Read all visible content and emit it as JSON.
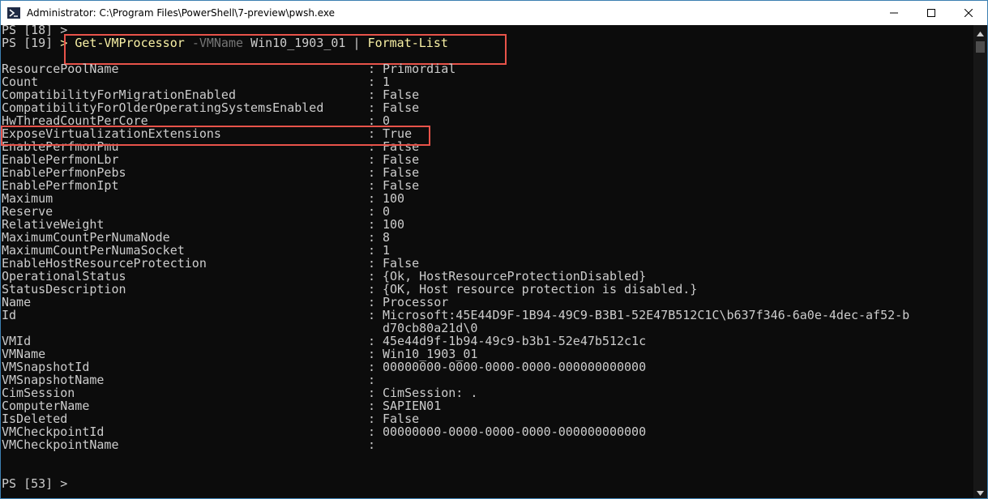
{
  "window": {
    "title": "Administrator: C:\\Program Files\\PowerShell\\7-preview\\pwsh.exe",
    "icon": "powershell-icon"
  },
  "controls": {
    "minimize": "minimize-icon",
    "maximize": "maximize-icon",
    "close": "close-icon"
  },
  "colors": {
    "highlight": "#e8534a",
    "background": "#0c0c0c",
    "text": "#cccccc",
    "command": "#f9f1a5",
    "parameter": "#767676"
  },
  "terminal": {
    "prompt_prev": "PS [18] >",
    "prompt": "PS [19]",
    "command": {
      "arrow": ">",
      "cmdlet": "Get-VMProcessor",
      "param": "-VMName",
      "arg": "Win10_1903_01",
      "pipe": "|",
      "cmdlet2": "Format-List"
    },
    "properties": [
      {
        "name": "ResourcePoolName",
        "value": "Primordial"
      },
      {
        "name": "Count",
        "value": "1"
      },
      {
        "name": "CompatibilityForMigrationEnabled",
        "value": "False"
      },
      {
        "name": "CompatibilityForOlderOperatingSystemsEnabled",
        "value": "False"
      },
      {
        "name": "HwThreadCountPerCore",
        "value": "0"
      },
      {
        "name": "ExposeVirtualizationExtensions",
        "value": "True"
      },
      {
        "name": "EnablePerfmonPmu",
        "value": "False"
      },
      {
        "name": "EnablePerfmonLbr",
        "value": "False"
      },
      {
        "name": "EnablePerfmonPebs",
        "value": "False"
      },
      {
        "name": "EnablePerfmonIpt",
        "value": "False"
      },
      {
        "name": "Maximum",
        "value": "100"
      },
      {
        "name": "Reserve",
        "value": "0"
      },
      {
        "name": "RelativeWeight",
        "value": "100"
      },
      {
        "name": "MaximumCountPerNumaNode",
        "value": "8"
      },
      {
        "name": "MaximumCountPerNumaSocket",
        "value": "1"
      },
      {
        "name": "EnableHostResourceProtection",
        "value": "False"
      },
      {
        "name": "OperationalStatus",
        "value": "{Ok, HostResourceProtectionDisabled}"
      },
      {
        "name": "StatusDescription",
        "value": "{OK, Host resource protection is disabled.}"
      },
      {
        "name": "Name",
        "value": "Processor"
      },
      {
        "name": "Id",
        "value": "Microsoft:45E44D9F-1B94-49C9-B3B1-52E47B512C1C\\b637f346-6a0e-4dec-af52-b"
      },
      {
        "name": "",
        "value": "d70cb80a21d\\0"
      },
      {
        "name": "VMId",
        "value": "45e44d9f-1b94-49c9-b3b1-52e47b512c1c"
      },
      {
        "name": "VMName",
        "value": "Win10_1903_01"
      },
      {
        "name": "VMSnapshotId",
        "value": "00000000-0000-0000-0000-000000000000"
      },
      {
        "name": "VMSnapshotName",
        "value": ""
      },
      {
        "name": "CimSession",
        "value": "CimSession: ."
      },
      {
        "name": "ComputerName",
        "value": "SAPIEN01"
      },
      {
        "name": "IsDeleted",
        "value": "False"
      },
      {
        "name": "VMCheckpointId",
        "value": "00000000-0000-0000-0000-000000000000"
      },
      {
        "name": "VMCheckpointName",
        "value": ""
      }
    ],
    "separator": ":",
    "prompt_final": "PS [53] >"
  }
}
